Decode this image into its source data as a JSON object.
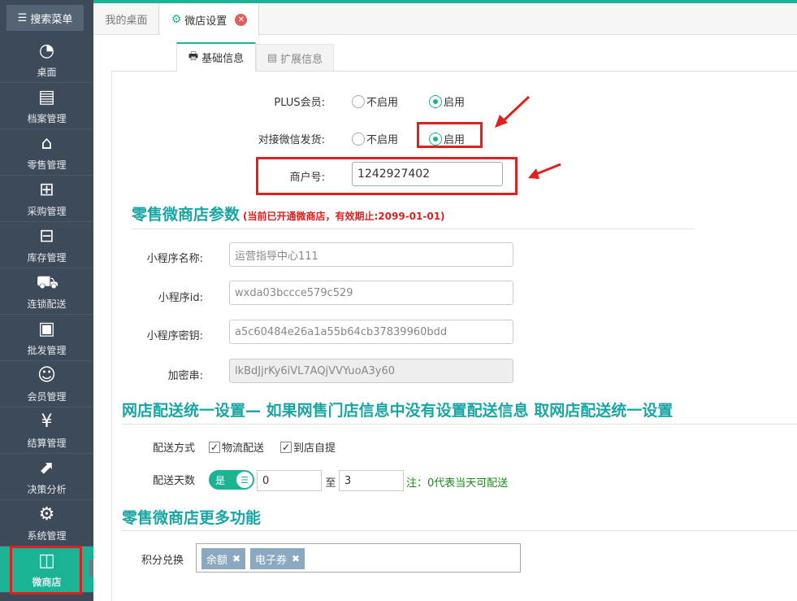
{
  "sidebar": {
    "search_label": "搜索菜单",
    "items": [
      {
        "label": "桌面",
        "icon": "dashboard-icon"
      },
      {
        "label": "档案管理",
        "icon": "archive-icon"
      },
      {
        "label": "零售管理",
        "icon": "store-icon"
      },
      {
        "label": "采购管理",
        "icon": "purchase-icon"
      },
      {
        "label": "库存管理",
        "icon": "inventory-icon"
      },
      {
        "label": "连锁配送",
        "icon": "truck-icon"
      },
      {
        "label": "批发管理",
        "icon": "wholesale-icon"
      },
      {
        "label": "会员管理",
        "icon": "member-icon"
      },
      {
        "label": "结算管理",
        "icon": "settlement-icon"
      },
      {
        "label": "决策分析",
        "icon": "analysis-icon"
      },
      {
        "label": "系统管理",
        "icon": "settings-icon"
      },
      {
        "label": "微商店",
        "icon": "shopping-bag-icon"
      }
    ],
    "active_index": 11
  },
  "tabs": {
    "home": "我的桌面",
    "active": "微店设置"
  },
  "subtabs": {
    "basic": "基础信息",
    "extended": "扩展信息"
  },
  "form": {
    "plus_member_label": "PLUS会员:",
    "wechat_ship_label": "对接微信发货:",
    "disable_label": "不启用",
    "enable_label": "启用",
    "plus_member_value": "enable",
    "wechat_ship_value": "enable",
    "merchant_label": "商户号:",
    "merchant_value": "1242927402"
  },
  "retail_params": {
    "title": "零售微商店参数",
    "note": "(当前已开通微商店，有效期止:2099-01-01)",
    "app_name_label": "小程序名称:",
    "app_name_value": "运营指导中心111",
    "app_id_label": "小程序id:",
    "app_id_value": "wxda03bccce579c529",
    "app_secret_label": "小程序密钥:",
    "app_secret_value": "a5c60484e26a1a55b64cb37839960bdd",
    "encrypt_label": "加密串:",
    "encrypt_value": "lkBdJjrKy6iVL7AQjVVYuoA3y60"
  },
  "delivery": {
    "title": "网店配送统一设置— 如果网售门店信息中没有设置配送信息 取网店配送统一设置",
    "method_label": "配送方式",
    "logistics_label": "物流配送",
    "pickup_label": "到店自提",
    "logistics_checked": true,
    "pickup_checked": true,
    "days_label": "配送天数",
    "toggle_label": "是",
    "days_from": "0",
    "to_label": "至",
    "days_to": "3",
    "note": "注：0代表当天可配送"
  },
  "more": {
    "title": "零售微商店更多功能",
    "points_label": "积分兑换",
    "tags": [
      "余额",
      "电子券"
    ]
  },
  "colors": {
    "accent": "#1ab394",
    "sidebar_bg": "#3c4a5a",
    "highlight_red": "#e02020",
    "section_title": "#1aa5a5"
  }
}
